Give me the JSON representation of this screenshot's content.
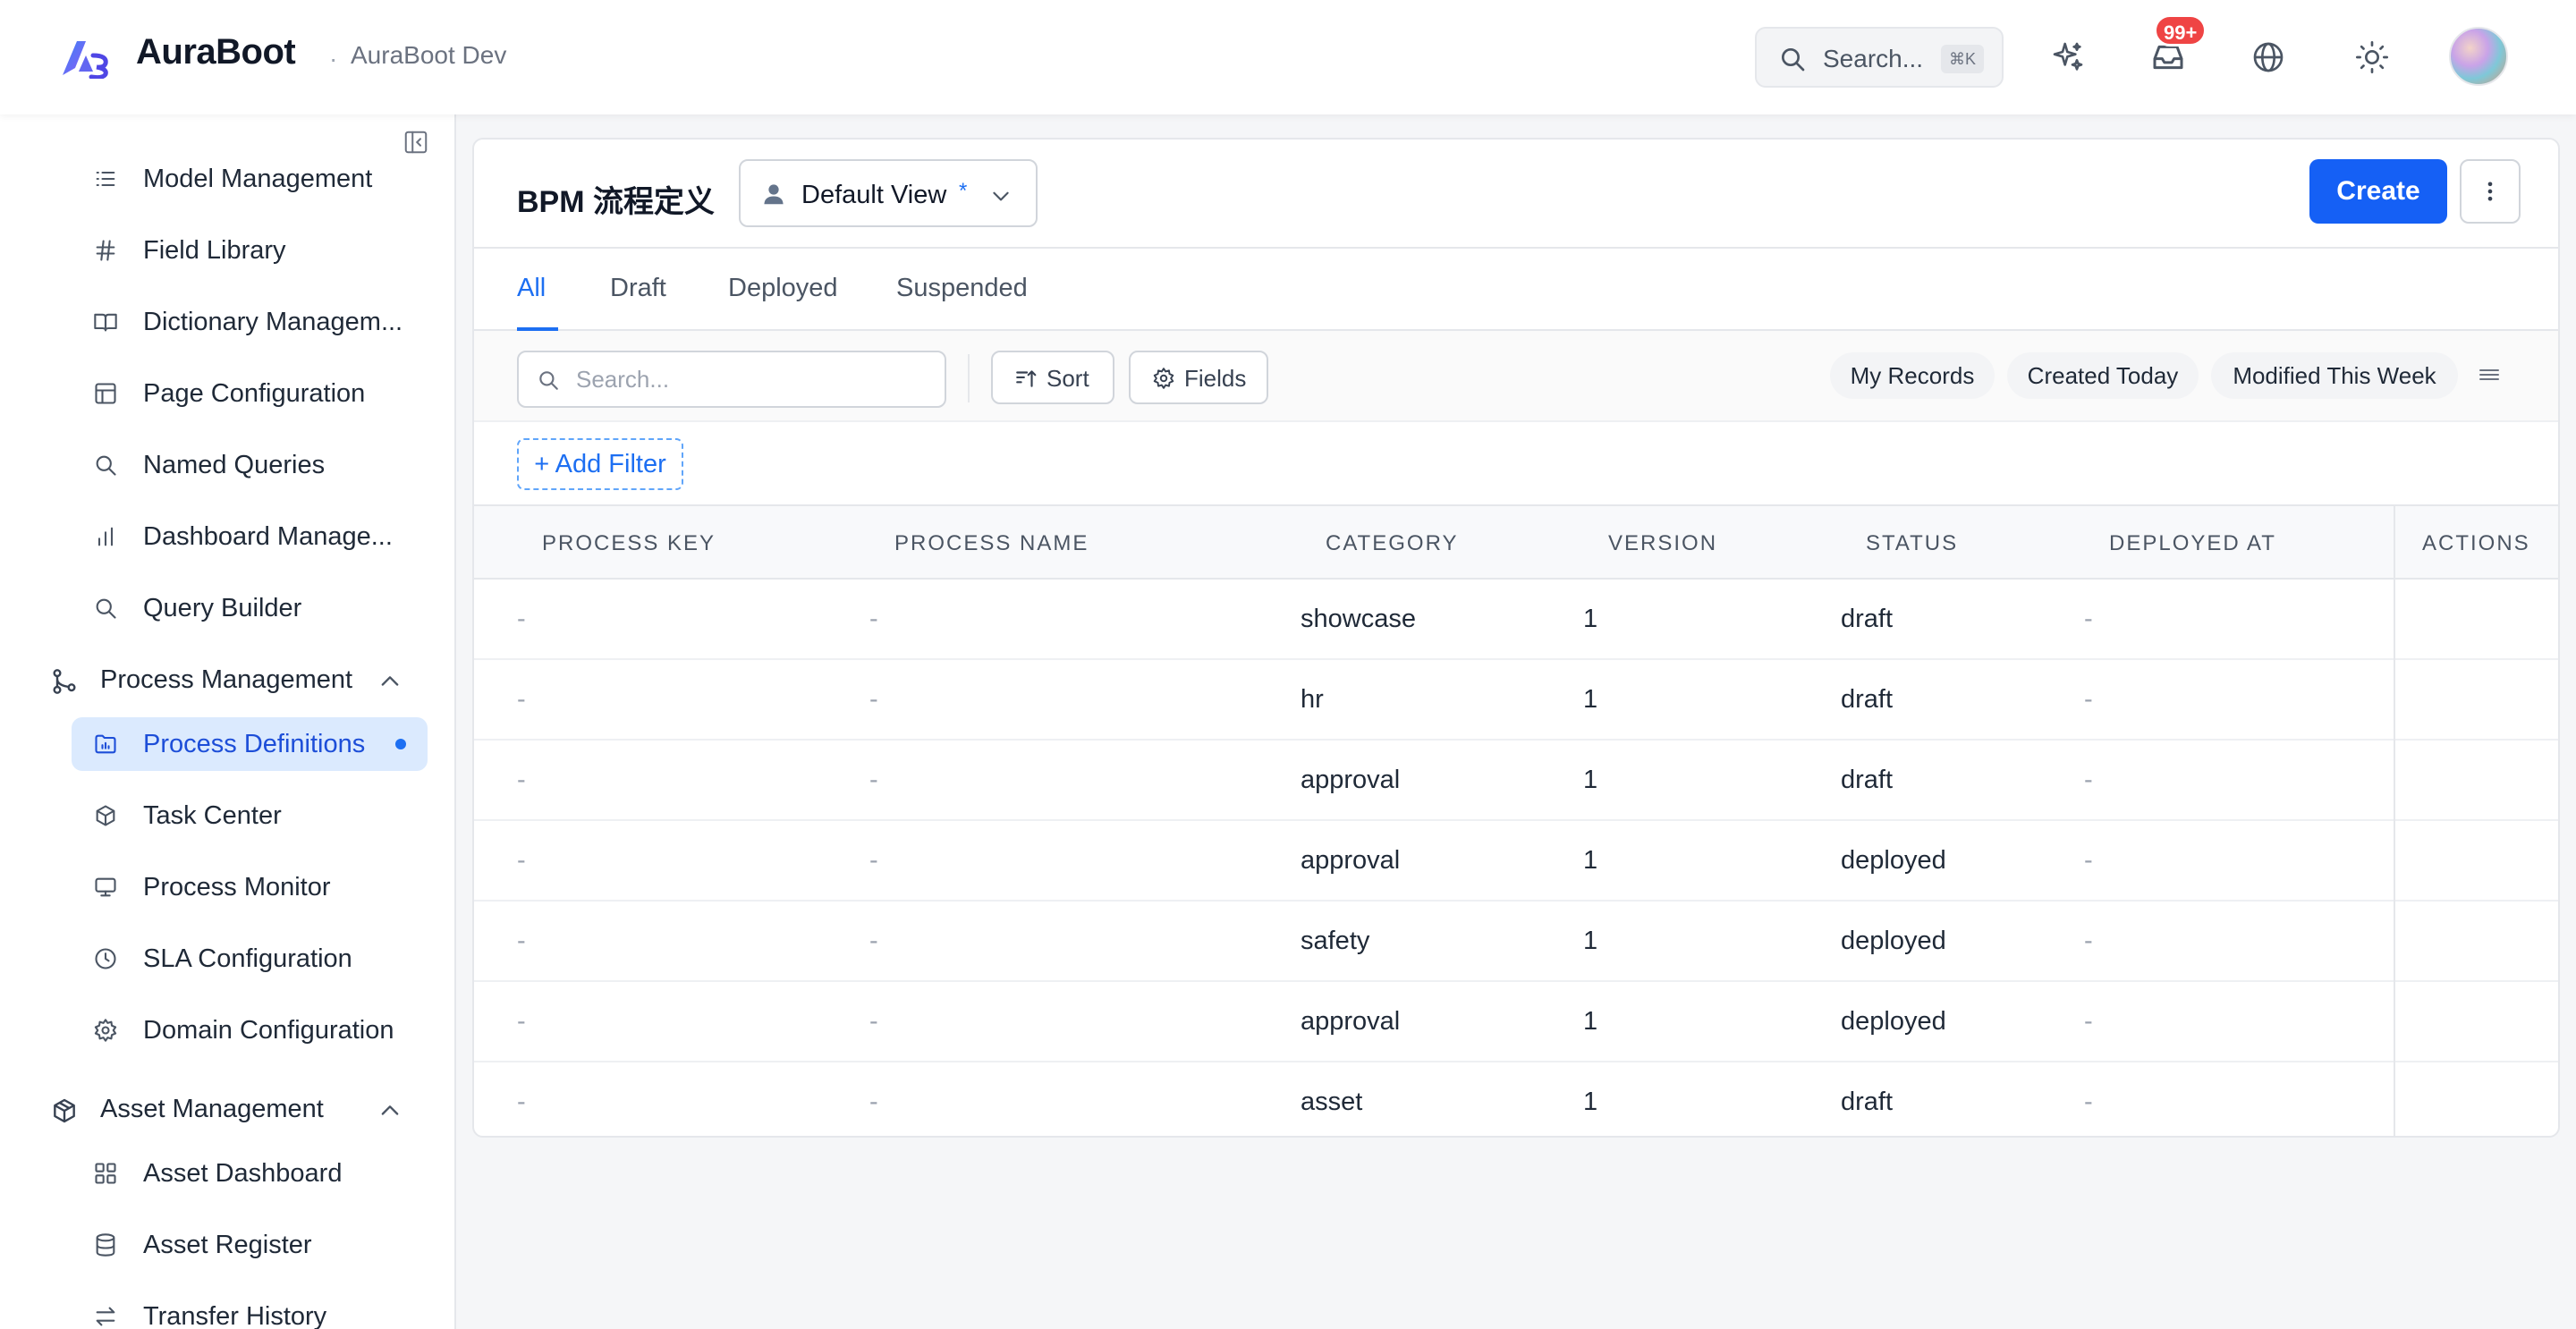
{
  "header": {
    "app_name": "AuraBoot",
    "env_separator": "·",
    "env_name": "AuraBoot Dev",
    "search_placeholder": "Search...",
    "search_shortcut": "⌘K",
    "notification_badge": "99+"
  },
  "sidebar": {
    "items_top": [
      {
        "label": "Model Management",
        "icon": "list-icon"
      },
      {
        "label": "Field Library",
        "icon": "hash-icon"
      },
      {
        "label": "Dictionary Managem...",
        "icon": "book-icon"
      },
      {
        "label": "Page Configuration",
        "icon": "layout-icon"
      },
      {
        "label": "Named Queries",
        "icon": "search-icon"
      },
      {
        "label": "Dashboard Manage...",
        "icon": "bar-chart-icon"
      },
      {
        "label": "Query Builder",
        "icon": "search-icon"
      }
    ],
    "group_process": {
      "label": "Process Management",
      "icon": "git-branch-icon"
    },
    "items_process": [
      {
        "label": "Process Definitions",
        "icon": "folder-chart-icon",
        "active": true
      },
      {
        "label": "Task Center",
        "icon": "cube-icon"
      },
      {
        "label": "Process Monitor",
        "icon": "monitor-icon"
      },
      {
        "label": "SLA Configuration",
        "icon": "clock-icon"
      },
      {
        "label": "Domain Configuration",
        "icon": "gear-icon"
      }
    ],
    "group_asset": {
      "label": "Asset Management",
      "icon": "package-icon"
    },
    "items_asset": [
      {
        "label": "Asset Dashboard",
        "icon": "grid-icon"
      },
      {
        "label": "Asset Register",
        "icon": "database-icon"
      },
      {
        "label": "Transfer History",
        "icon": "swap-icon"
      }
    ]
  },
  "page": {
    "title": "BPM 流程定义",
    "view_label": "Default View",
    "view_modified_marker": "*",
    "create_label": "Create"
  },
  "tabs": [
    "All",
    "Draft",
    "Deployed",
    "Suspended"
  ],
  "active_tab": "All",
  "toolbar": {
    "search_placeholder": "Search...",
    "sort_label": "Sort",
    "fields_label": "Fields",
    "quick_filters": [
      "My Records",
      "Created Today",
      "Modified This Week"
    ]
  },
  "filter": {
    "add_label": "+ Add Filter"
  },
  "table": {
    "columns": [
      "PROCESS KEY",
      "PROCESS NAME",
      "CATEGORY",
      "VERSION",
      "STATUS",
      "DEPLOYED AT",
      "ACTIONS"
    ],
    "rows": [
      [
        "-",
        "-",
        "showcase",
        "1",
        "draft",
        "-"
      ],
      [
        "-",
        "-",
        "hr",
        "1",
        "draft",
        "-"
      ],
      [
        "-",
        "-",
        "approval",
        "1",
        "draft",
        "-"
      ],
      [
        "-",
        "-",
        "approval",
        "1",
        "deployed",
        "-"
      ],
      [
        "-",
        "-",
        "safety",
        "1",
        "deployed",
        "-"
      ],
      [
        "-",
        "-",
        "approval",
        "1",
        "deployed",
        "-"
      ],
      [
        "-",
        "-",
        "asset",
        "1",
        "draft",
        "-"
      ]
    ]
  },
  "colors": {
    "accent": "#1d6ff2",
    "create_button": "#1560f5",
    "active_nav_bg": "#dbeafe",
    "badge": "#ef4444"
  }
}
